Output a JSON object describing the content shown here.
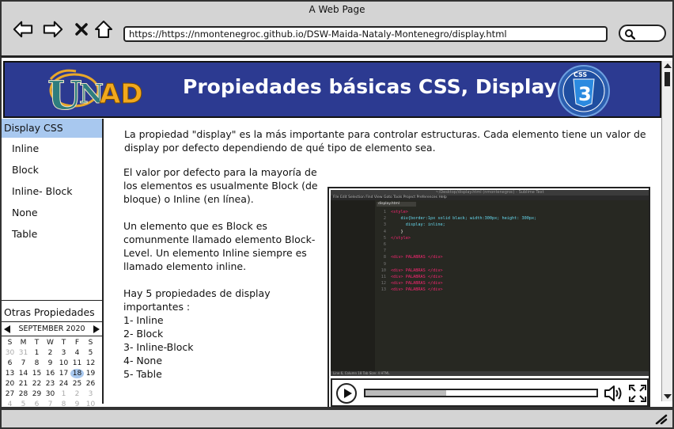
{
  "window": {
    "title": "A Web Page",
    "url": "https://https://nmontenegroc.github.io/DSW-Maida-Nataly-Montenegro/display.html"
  },
  "banner": {
    "logo_text": "UNAD",
    "title": "Propiedades básicas CSS, Display",
    "css_logo_label": "CSS",
    "css_logo_version": "3"
  },
  "sidebar": {
    "header": "Display CSS",
    "items": [
      {
        "label": "Inline"
      },
      {
        "label": "Block"
      },
      {
        "label": "Inline- Block"
      },
      {
        "label": "None"
      },
      {
        "label": "Table"
      }
    ],
    "other_header": "Otras Propiedades"
  },
  "calendar": {
    "month_label": "SEPTEMBER 2020",
    "weekdays": [
      "S",
      "M",
      "T",
      "W",
      "T",
      "F",
      "S"
    ],
    "selected_day": "18",
    "weeks": [
      [
        {
          "d": "30",
          "dim": true
        },
        {
          "d": "31",
          "dim": true
        },
        {
          "d": "1"
        },
        {
          "d": "2"
        },
        {
          "d": "3"
        },
        {
          "d": "4"
        },
        {
          "d": "5"
        }
      ],
      [
        {
          "d": "6"
        },
        {
          "d": "7"
        },
        {
          "d": "8"
        },
        {
          "d": "9"
        },
        {
          "d": "10"
        },
        {
          "d": "11"
        },
        {
          "d": "12"
        }
      ],
      [
        {
          "d": "13"
        },
        {
          "d": "14"
        },
        {
          "d": "15"
        },
        {
          "d": "16"
        },
        {
          "d": "17"
        },
        {
          "d": "18"
        },
        {
          "d": "19"
        }
      ],
      [
        {
          "d": "20"
        },
        {
          "d": "21"
        },
        {
          "d": "22"
        },
        {
          "d": "23"
        },
        {
          "d": "24"
        },
        {
          "d": "25"
        },
        {
          "d": "26"
        }
      ],
      [
        {
          "d": "27"
        },
        {
          "d": "28"
        },
        {
          "d": "29"
        },
        {
          "d": "30"
        },
        {
          "d": "1",
          "dim": true
        },
        {
          "d": "2",
          "dim": true
        },
        {
          "d": "3",
          "dim": true
        }
      ],
      [
        {
          "d": "4",
          "dim": true
        },
        {
          "d": "5",
          "dim": true
        },
        {
          "d": "6",
          "dim": true
        },
        {
          "d": "7",
          "dim": true
        },
        {
          "d": "8",
          "dim": true
        },
        {
          "d": "9",
          "dim": true
        },
        {
          "d": "10",
          "dim": true
        }
      ]
    ]
  },
  "content": {
    "intro": "La propiedad \"display\"  es la más importante para controlar estructuras. Cada elemento tiene un valor de display por defecto dependiendo de qué tipo de elemento sea.",
    "para1": "El valor por defecto para la mayoría de los elementos es usualmente Block (de bloque) o Inline (en línea).",
    "para2": "Un elemento que es Block es comunmente llamado elemento Block-Level. Un elemento Inline siempre es llamado elemento inline.",
    "list_intro": "Hay 5 propiedades de display importantes :",
    "list": [
      "1-  Inline",
      "2- Block",
      "3- Inline-Block",
      "4- None",
      "5- Table"
    ]
  },
  "video": {
    "editor_title": "~/Desktop/display.html (nmontenegroc) - Sublime Text",
    "editor_menu": "File  Edit  Selection  Find  View  Goto  Tools  Project  Preferences  Help",
    "editor_tab": "display.html",
    "editor_status": "Line 6, Column 18   Tab Size: 4   HTML",
    "code_lines": [
      [
        "1",
        "<style>"
      ],
      [
        "2",
        "    div{border:1px solid black; width:300px; height: 300px;"
      ],
      [
        "3",
        "      display: inline;"
      ],
      [
        "4",
        "    }"
      ],
      [
        "5",
        "</style>"
      ],
      [
        "6",
        ""
      ],
      [
        "7",
        ""
      ],
      [
        "8",
        "<div> PALABRAS </div>"
      ],
      [
        "9",
        ""
      ],
      [
        "10",
        "<div> PALABRAS </div>"
      ],
      [
        "11",
        "<div> PALABRAS </div>"
      ],
      [
        "12",
        "<div> PALABRAS </div>"
      ],
      [
        "13",
        "<div> PALABRAS </div>"
      ]
    ],
    "progress_fraction": 0.35
  },
  "icons": {
    "back": "arrow-left-icon",
    "forward": "arrow-right-icon",
    "stop": "close-icon",
    "home": "home-icon",
    "search": "search-icon",
    "play": "play-icon",
    "volume": "volume-icon",
    "fullscreen": "fullscreen-icon"
  }
}
